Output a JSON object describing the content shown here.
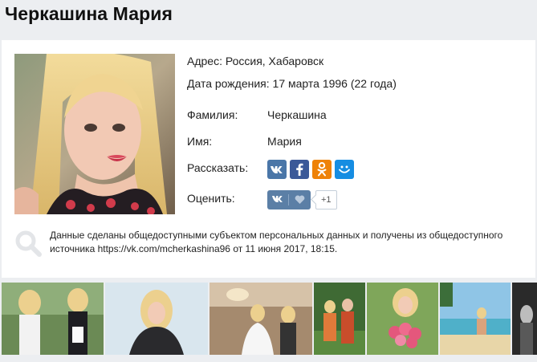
{
  "page_title": "Черкашина Мария",
  "profile": {
    "address_line": "Адрес: Россия, Хабаровск",
    "birthdate_line": "Дата рождения: 17 марта 1996 (22 года)",
    "surname_label": "Фамилия:",
    "surname_value": "Черкашина",
    "name_label": "Имя:",
    "name_value": "Мария",
    "share_label": "Рассказать:",
    "rate_label": "Оценить:"
  },
  "share_buttons": [
    {
      "network": "vk",
      "glyph": "vk",
      "color": "#4a76a8"
    },
    {
      "network": "facebook",
      "glyph": "f",
      "color": "#3b5998"
    },
    {
      "network": "odnoklassniki",
      "glyph": "ok",
      "color": "#ee8208"
    },
    {
      "network": "moimir",
      "glyph": "mm",
      "color": "#168de2"
    }
  ],
  "rating": {
    "vk_label": "vk",
    "count": "+1"
  },
  "notice": {
    "text": "Данные сделаны общедоступными субъектом персональных данных и получены из общедоступного источника https://vk.com/mcherkashina96 от 11 июня 2017, 18:15."
  },
  "colors": {
    "page_bg": "#eceef1",
    "card_bg": "#ffffff",
    "rate_button": "#5b7fa6"
  }
}
